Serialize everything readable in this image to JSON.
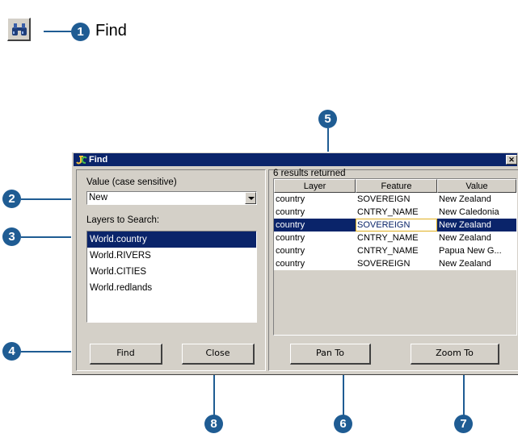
{
  "legend": {
    "badge": "1",
    "label": "Find"
  },
  "window": {
    "title": "Find",
    "close_glyph": "✕"
  },
  "left": {
    "value_label": "Value (case sensitive)",
    "value_input": "New",
    "layers_label": "Layers to Search:",
    "layers": [
      "World.country",
      "World.RIVERS",
      "World.CITIES",
      "World.redlands"
    ],
    "selected_layer_index": 0,
    "find_button": "Find",
    "close_button": "Close"
  },
  "right": {
    "status": "6 results returned",
    "columns": [
      "Layer",
      "Feature",
      "Value"
    ],
    "rows": [
      [
        "country",
        "SOVEREIGN",
        "New Zealand"
      ],
      [
        "country",
        "CNTRY_NAME",
        "New Caledonia"
      ],
      [
        "country",
        "SOVEREIGN",
        "New Zealand"
      ],
      [
        "country",
        "CNTRY_NAME",
        "New Zealand"
      ],
      [
        "country",
        "CNTRY_NAME",
        "Papua New G..."
      ],
      [
        "country",
        "SOVEREIGN",
        "New Zealand"
      ]
    ],
    "selected_row_index": 2,
    "pan_button": "Pan To",
    "zoom_button": "Zoom To"
  },
  "callouts": [
    "2",
    "3",
    "4",
    "5",
    "6",
    "7",
    "8"
  ],
  "colors": {
    "callout": "#1f5c93",
    "titlebar": "#0a246a",
    "dialog_face": "#d4d0c8"
  }
}
